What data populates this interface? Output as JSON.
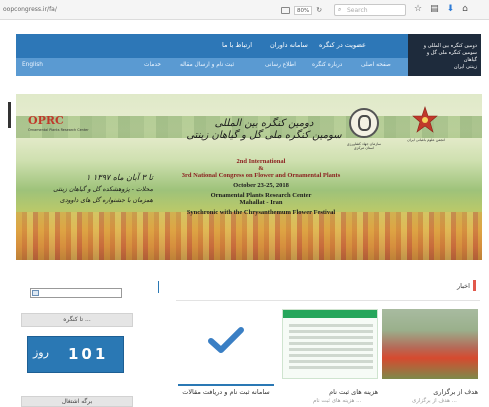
{
  "browser": {
    "url": "oopcongress.ir/fa/",
    "zoom": "80%",
    "search_placeholder": "Search"
  },
  "nav": {
    "top": [
      "عضویت در کنگره",
      "سامانه داوران",
      "ارتباط با ما"
    ],
    "bottom": [
      "صفحه اصلی",
      "درباره کنگره",
      "اطلاع رسانی",
      "ثبت نام و ارسال مقاله",
      "خدمات"
    ],
    "english": "English",
    "logo_line1": "دومین کنگره بین المللی و",
    "logo_line2": "سومین کنگره ملی گل و گیاهان",
    "logo_line3": "زینتی ایران"
  },
  "banner": {
    "oprc": "OPRC",
    "oprc_sub": "Ornamental Plants Research Center",
    "fa_title_1": "دومین کنگره بین المللی",
    "fa_title_2": "سومین کنگره ملی گل و گیاهان زینتی",
    "en_line_1": "2nd International",
    "en_line_2": "&",
    "en_line_3": "3rd National Congress on Flower and Ornamental Plants",
    "en_line_4": "October 23-25, 2018",
    "en_line_5": "Ornamental Plants Research Center",
    "en_line_6": "Mahallat - Iran",
    "en_line_7": "Synchronic with the Chrysanthemum Flower Festival",
    "fa_left_1": "۱ تا ۳ آبان ماه ۱۳۹۷",
    "fa_left_2": "محلات - پژوهشکده گل و گیاهان زینتی",
    "fa_left_3": "همزمان با جشنواره گل های داوودی",
    "jihad_label_1": "سازمان جهاد کشاورزی",
    "jihad_label_2": "استان مرکزی",
    "iran_label": "انجمن علوم باغبانی ایران"
  },
  "sidebar": {
    "until_congress": "تا کنگره ...",
    "days_number": "101",
    "days_label": "روز",
    "bottom_label": "برگه اشتغال"
  },
  "main": {
    "news_heading": "اخبار",
    "cards": [
      {
        "title": "هدف از برگزاری",
        "snippet": "هدف از برگزاری ..."
      },
      {
        "title": "هزینه های ثبت نام",
        "snippet": "هزینه های ثبت نام ..."
      },
      {
        "title": "سامانه ثبت نام و دریافت مقالات",
        "snippet": ""
      }
    ]
  },
  "colors": {
    "nav_dark": "#2d77b7",
    "nav_light": "#5a9ad2",
    "countdown_bg": "#2a78b4",
    "check_color": "#3a7fc4"
  }
}
